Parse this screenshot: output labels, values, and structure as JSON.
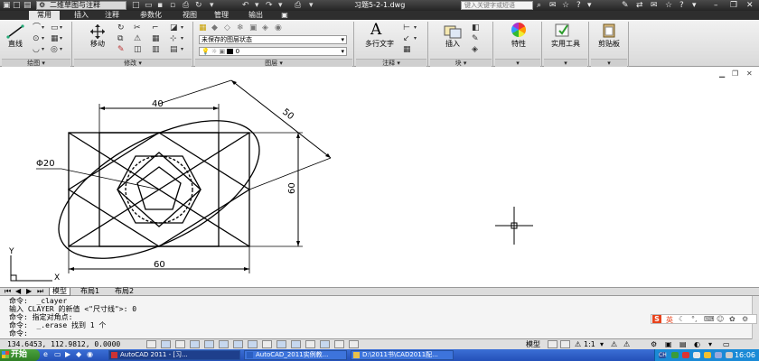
{
  "titlebar": {
    "workspace": "二维草图与注释",
    "doc_title": "习题5-2-1.dwg",
    "search_placeholder": "键入关键字或短语"
  },
  "tabs": [
    "常用",
    "插入",
    "注释",
    "参数化",
    "视图",
    "管理",
    "输出"
  ],
  "ribbon": {
    "draw_line_label": "直线",
    "draw_panel": "绘图",
    "move_label": "移动",
    "modify_panel": "修改",
    "layer_state": "未保存的图层状态",
    "layer_current": "0",
    "layer_panel": "图层",
    "mtext_label": "多行文字",
    "annotation_panel": "注释",
    "insert_label": "插入",
    "block_panel": "块",
    "properties_label": "特性",
    "utilities_label": "实用工具",
    "clipboard_label": "剪贴板"
  },
  "drawing": {
    "dim_40": "40",
    "dim_50": "50",
    "dim_60_vertical": "60",
    "dim_60_horizontal": "60",
    "dim_phi20": "Φ20",
    "ucs_x": "X",
    "ucs_y": "Y"
  },
  "layout_tabs": [
    "模型",
    "布局1",
    "布局2"
  ],
  "command_lines": [
    "命令:  _clayer",
    "输入 CLAYER 的新值 <\"尺寸线\">: 0",
    "命令: 指定对角点:",
    "命令:  _.erase 找到 1 个",
    "命令:"
  ],
  "status": {
    "coords": "134.6453, 112.9812, 0.0000",
    "model_label": "模型",
    "scale_label": "1:1"
  },
  "taskbar": {
    "start_label": "开始",
    "tasks": [
      "AutoCAD 2011 - [习...",
      "AutoCAD_2011实例教...",
      "D:\\2011书\\CAD2011配..."
    ],
    "clock": "16:06"
  },
  "colors": {
    "titlebar": "#242424",
    "ribbon": "#e6e6e6",
    "taskbar": "#2450b8",
    "start_button": "#2f7e24"
  }
}
